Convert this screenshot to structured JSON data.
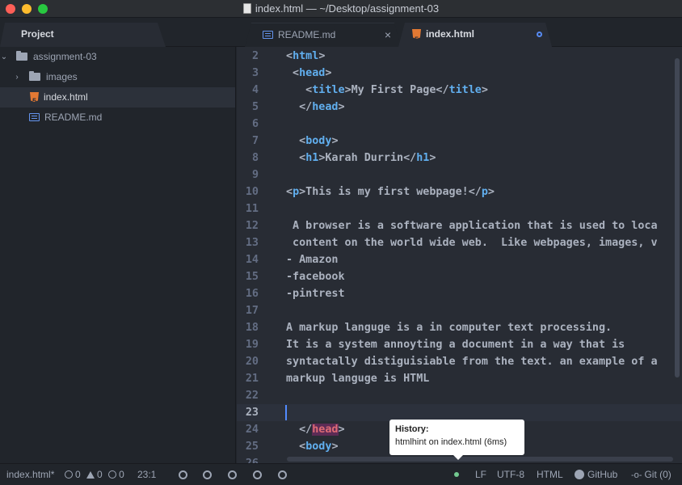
{
  "window": {
    "title": "index.html — ~/Desktop/assignment-03"
  },
  "tabs": {
    "project": "Project",
    "readme": "README.md",
    "index": "index.html",
    "close_glyph": "×"
  },
  "tree": {
    "root": "assignment-03",
    "items": [
      {
        "label": "images"
      },
      {
        "label": "index.html"
      },
      {
        "label": "README.md"
      }
    ]
  },
  "editor": {
    "lines": [
      {
        "n": "2",
        "text": "<html>"
      },
      {
        "n": "3",
        "text": " <head>"
      },
      {
        "n": "4",
        "text": "   <title>My First Page</title>"
      },
      {
        "n": "5",
        "text": "  </head>"
      },
      {
        "n": "6",
        "text": ""
      },
      {
        "n": "7",
        "text": "  <body>"
      },
      {
        "n": "8",
        "text": "  <h1>Karah Durrin</h1>"
      },
      {
        "n": "9",
        "text": ""
      },
      {
        "n": "10",
        "text": "<p>This is my first webpage!</p>"
      },
      {
        "n": "11",
        "text": ""
      },
      {
        "n": "12",
        "text": " A browser is a software application that is used to loca"
      },
      {
        "n": "13",
        "text": " content on the world wide web.  Like webpages, images, v"
      },
      {
        "n": "14",
        "text": "- Amazon"
      },
      {
        "n": "15",
        "text": "-facebook"
      },
      {
        "n": "16",
        "text": "-pintrest"
      },
      {
        "n": "17",
        "text": ""
      },
      {
        "n": "18",
        "text": "A markup languge is a in computer text processing."
      },
      {
        "n": "19",
        "text": "It is a system annoyting a document in a way that is"
      },
      {
        "n": "20",
        "text": "syntactally distiguisiable from the text. an example of a"
      },
      {
        "n": "21",
        "text": "markup languge is HTML"
      },
      {
        "n": "22",
        "text": ""
      },
      {
        "n": "23",
        "text": ""
      },
      {
        "n": "24",
        "text": "  </head>"
      },
      {
        "n": "25",
        "text": "  <body>"
      },
      {
        "n": "26",
        "text": ""
      }
    ]
  },
  "tooltip": {
    "title": "History:",
    "text": "htmlhint on index.html (6ms)"
  },
  "status": {
    "file": "index.html*",
    "errors": "0",
    "warnings": "0",
    "infos": "0",
    "position": "23:1",
    "line_ending": "LF",
    "encoding": "UTF-8",
    "grammar": "HTML",
    "github": "GitHub",
    "git": "Git (0)"
  },
  "colors": {
    "tag": "#61afef",
    "highlight": "#e06c75",
    "accent": "#528bff",
    "html_icon": "#e37933",
    "md_icon": "#6494ed"
  }
}
